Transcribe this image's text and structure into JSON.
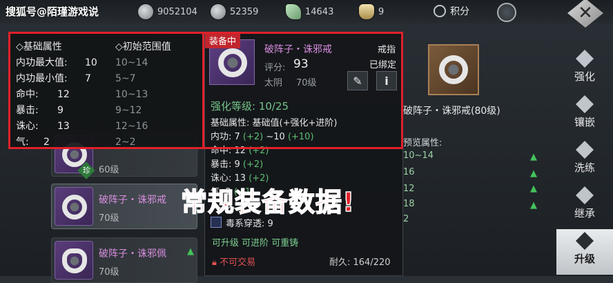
{
  "watermark": "搜狐号@陌瑾游戏说",
  "currencies": [
    {
      "icon": "silver-coin-icon",
      "value": "9052104"
    },
    {
      "icon": "bound-silver-icon",
      "value": "52359"
    },
    {
      "icon": "jade-leaf-icon",
      "value": "14643"
    },
    {
      "icon": "gold-ingot-icon",
      "value": "9"
    }
  ],
  "points_label": "积分",
  "close_label": "✕",
  "base_stats": {
    "header_left": "◇基础属性",
    "header_right": "◇初始范围值",
    "rows": [
      {
        "k": "内功最大值:",
        "v": "10",
        "r": "10~14"
      },
      {
        "k": "内功最小值:",
        "v": "7",
        "r": "5~7"
      },
      {
        "k": "命中:",
        "v": "12",
        "r": "10~13"
      },
      {
        "k": "暴击:",
        "v": "9",
        "r": "9~12"
      },
      {
        "k": "诛心:",
        "v": "13",
        "r": "12~16"
      },
      {
        "k": "气:",
        "v": "2",
        "r": "2~2"
      }
    ]
  },
  "item_list": [
    {
      "name": "",
      "level": "60级",
      "badge": "珍"
    },
    {
      "name": "破阵子・诛邪戒",
      "level": "70级"
    },
    {
      "name": "破阵子・诛邪佩",
      "level": "70级"
    }
  ],
  "detail": {
    "equipped_tag": "装备中",
    "name": "破阵子・诛邪戒",
    "type": "戒指",
    "bound": "已绑定",
    "score_label": "评分:",
    "score": "93",
    "affinity": "太阴",
    "level": "70级",
    "enhance": "强化等级: 10/25",
    "base_formula": "基础属性: 基础值(+强化+进阶)",
    "lines": [
      {
        "label": "内功: 7 ",
        "plus": "(+2)",
        "mid": " ~10 ",
        "plus2": "(+10)"
      },
      {
        "label": "命中: 12 ",
        "plus": "(+2)"
      },
      {
        "label": "暴击: 9 ",
        "plus": "(+2)"
      },
      {
        "label": "诛心: 13 ",
        "plus": "(+2)"
      },
      {
        "label": "气: 2 ",
        "plus": "(+1)"
      }
    ],
    "extra_lines": [
      {
        "label": "…36",
        "tail": "…36"
      }
    ],
    "poison": "毒系穿透: 9",
    "actions": "可升级 可进阶 可重铸",
    "not_tradable": "不可交易",
    "durability": "耐久: 164/220"
  },
  "overlay_caption": "常规装备数据!",
  "compare": {
    "name": "破阵子・诛邪戒(80级)",
    "preview": "预览属性:",
    "values": [
      "10~14",
      "16",
      "12",
      "18",
      "2"
    ]
  },
  "nav": [
    {
      "label": "强化",
      "icon": "hammer-icon"
    },
    {
      "label": "镶嵌",
      "icon": "gem-icon"
    },
    {
      "label": "洗练",
      "icon": "refine-icon"
    },
    {
      "label": "继承",
      "icon": "inherit-icon"
    },
    {
      "label": "升级",
      "icon": "upgrade-icon"
    }
  ]
}
